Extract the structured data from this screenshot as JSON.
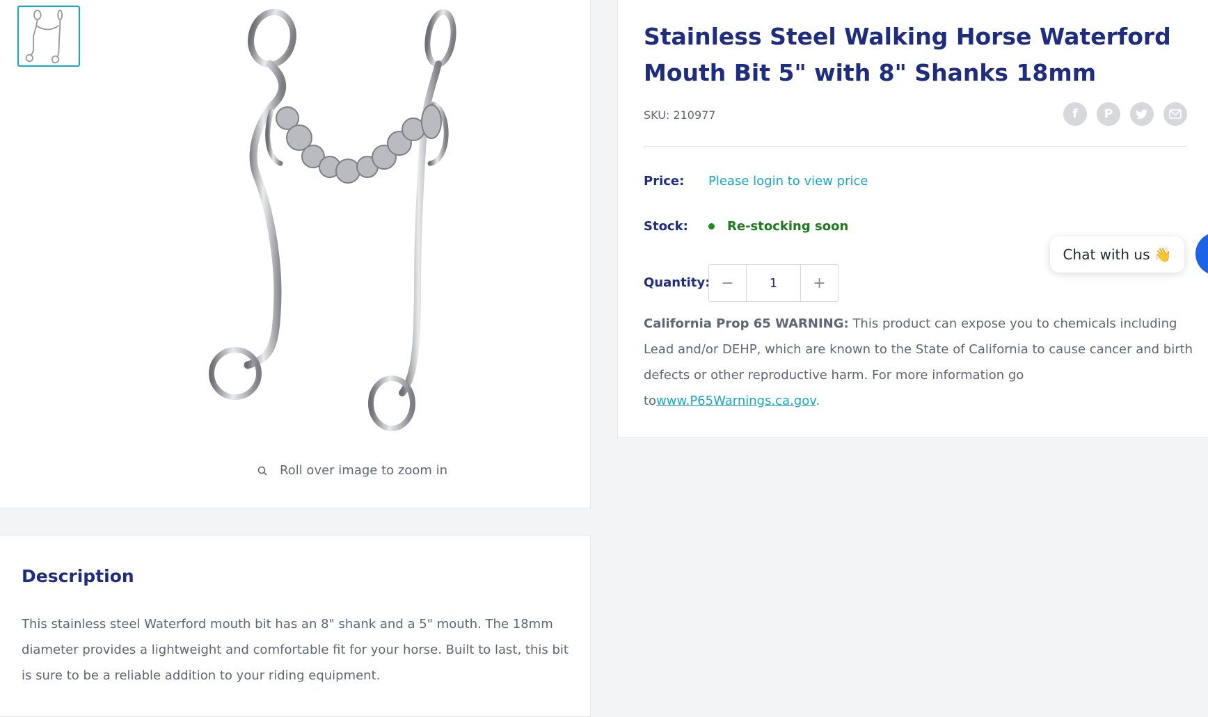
{
  "product": {
    "title": "Stainless Steel Walking Horse Waterford Mouth Bit 5\" with 8\" Shanks 18mm",
    "sku": "SKU: 210977",
    "price_label": "Price:",
    "price_link": "Please login to view price",
    "stock_label": "Stock:",
    "stock_status": "Re-stocking soon",
    "quantity_label": "Quantity:",
    "quantity_value": "1",
    "warning_bold": "California Prop 65 WARNING:",
    "warning_text": " This product can expose you to chemicals including Lead and/or DEHP, which are known to the State of California to cause cancer and birth defects or other reproductive harm. For more information go to",
    "warning_link": "www.P65Warnings.ca.gov",
    "warning_end": "."
  },
  "share_icons": [
    "facebook-icon",
    "pinterest-icon",
    "twitter-icon",
    "email-icon"
  ],
  "gallery": {
    "zoom_hint": "Roll over image to zoom in"
  },
  "description": {
    "title": "Description",
    "body": "This stainless steel Waterford mouth bit has an 8\" shank and a 5\" mouth. The 18mm diameter provides a lightweight and comfortable fit for your horse. Built to last, this bit is sure to be a reliable addition to your riding equipment."
  },
  "chat": {
    "label": "Chat with us",
    "emoji": "👋"
  },
  "colors": {
    "heading": "#1e2d7d",
    "accent": "#17a9c3",
    "stock_green": "#1c7b1c",
    "chat_blue": "#1d63e6"
  }
}
